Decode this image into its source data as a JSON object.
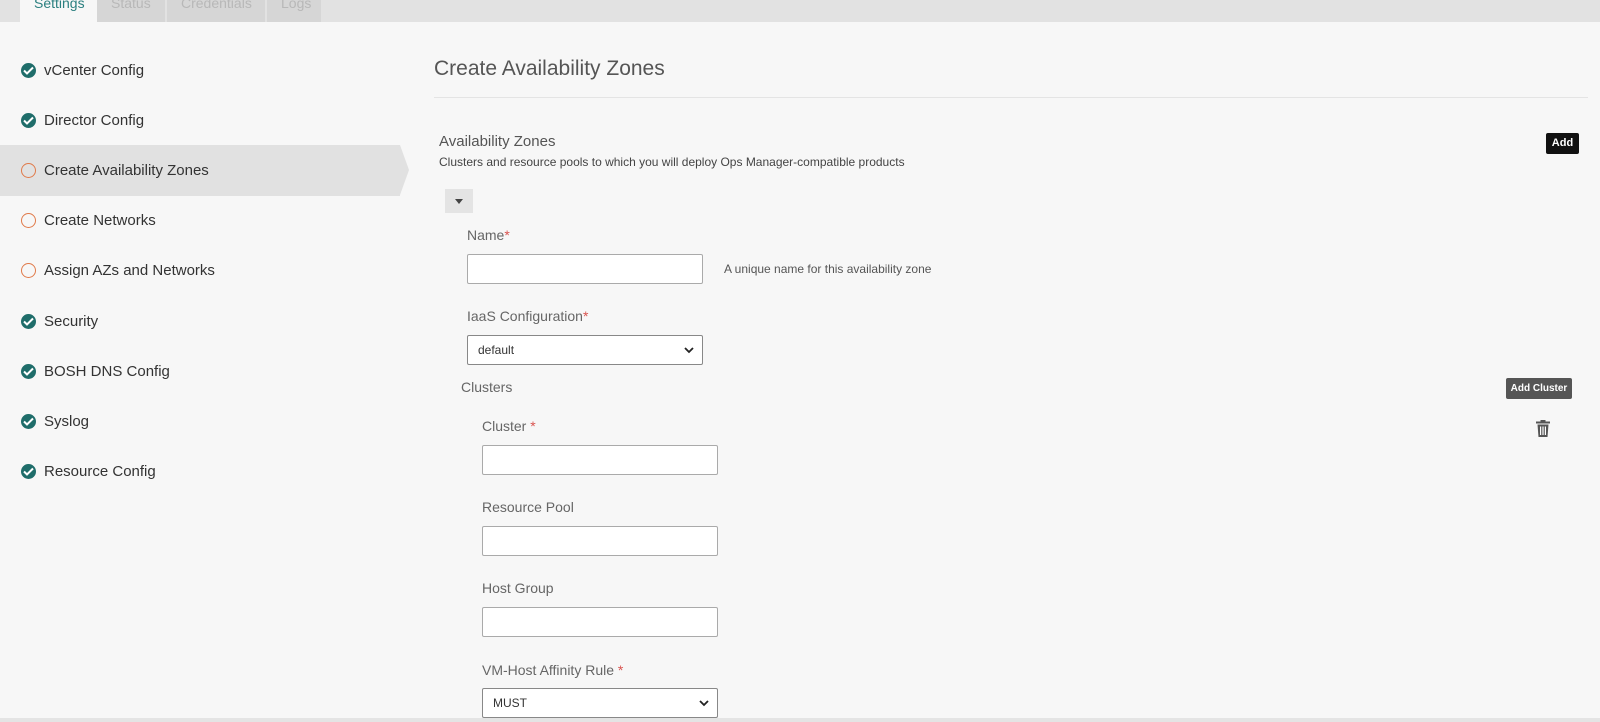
{
  "tabs": [
    {
      "label": "Settings"
    },
    {
      "label": "Status"
    },
    {
      "label": "Credentials"
    },
    {
      "label": "Logs"
    }
  ],
  "sidebar": {
    "items": [
      {
        "label": "vCenter Config",
        "status": "complete"
      },
      {
        "label": "Director Config",
        "status": "complete"
      },
      {
        "label": "Create Availability Zones",
        "status": "incomplete"
      },
      {
        "label": "Create Networks",
        "status": "incomplete"
      },
      {
        "label": "Assign AZs and Networks",
        "status": "incomplete"
      },
      {
        "label": "Security",
        "status": "complete"
      },
      {
        "label": "BOSH DNS Config",
        "status": "complete"
      },
      {
        "label": "Syslog",
        "status": "complete"
      },
      {
        "label": "Resource Config",
        "status": "complete"
      }
    ]
  },
  "main": {
    "title": "Create Availability Zones",
    "section": {
      "title": "Availability Zones",
      "description": "Clusters and resource pools to which you will deploy Ops Manager-compatible products",
      "add_label": "Add"
    },
    "form": {
      "name_label": "Name",
      "name_value": "",
      "name_hint": "A unique name for this availability zone",
      "iaas_label": "IaaS Configuration",
      "iaas_value": "default",
      "clusters_title": "Clusters",
      "add_cluster_label": "Add Cluster",
      "cluster_label": "Cluster ",
      "cluster_value": "",
      "resource_pool_label": "Resource Pool",
      "resource_pool_value": "",
      "host_group_label": "Host Group",
      "host_group_value": "",
      "affinity_label": "VM-Host Affinity Rule ",
      "affinity_value": "MUST",
      "required_mark": "*"
    }
  },
  "colors": {
    "accent": "#2a7f7f",
    "complete": "#1f6d6a",
    "incomplete": "#e07a4a",
    "required": "#d9534f"
  },
  "icons": {
    "complete": "check-circle-icon",
    "incomplete": "empty-circle-icon",
    "collapse": "caret-down-icon",
    "delete": "trash-icon",
    "select": "chevron-down-icon"
  }
}
